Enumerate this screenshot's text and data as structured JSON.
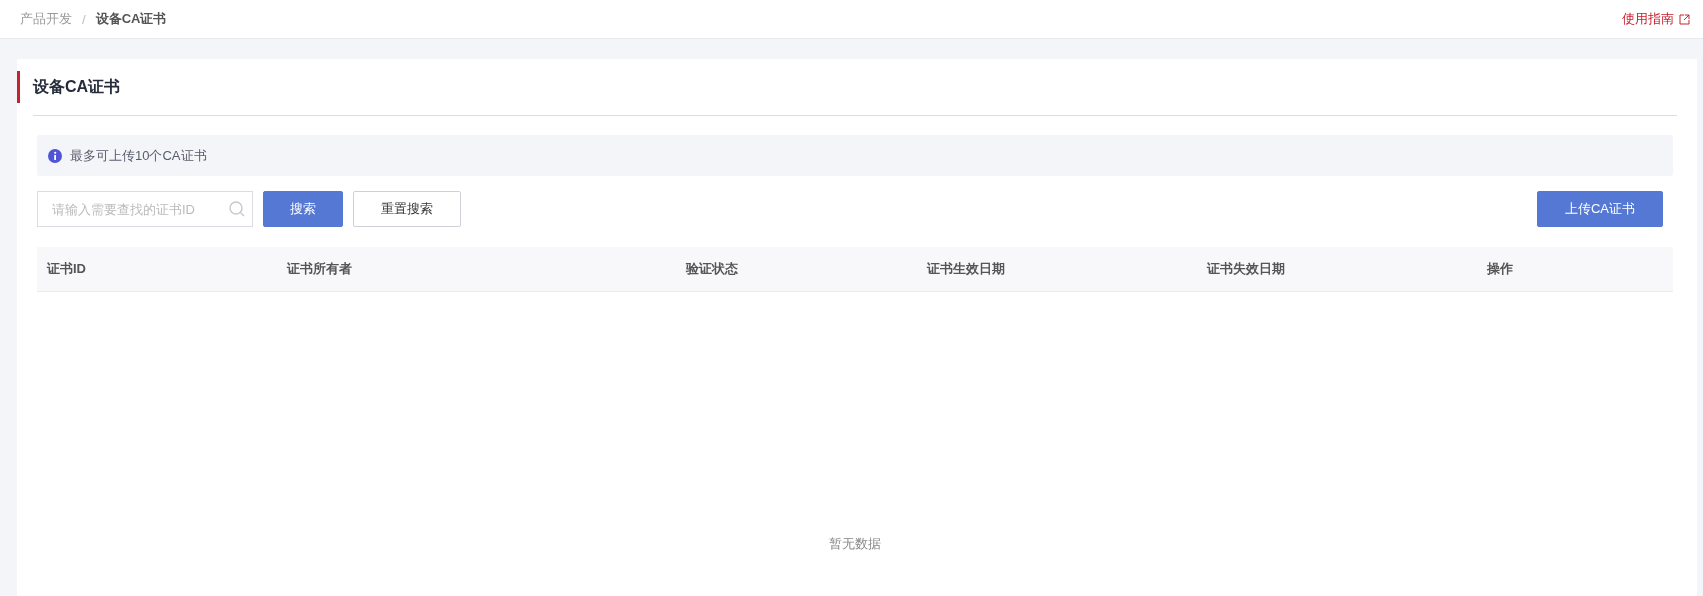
{
  "breadcrumb": [
    {
      "label": "产品开发",
      "current": false
    },
    {
      "label": "设备CA证书",
      "current": true
    }
  ],
  "separator": "/",
  "guide_link": {
    "label": "使用指南"
  },
  "page_title": "设备CA证书",
  "notice": "最多可上传10个CA证书",
  "search": {
    "placeholder": "请输入需要查找的证书ID"
  },
  "buttons": [
    {
      "label": "搜索",
      "kind": "primary"
    },
    {
      "label": "重置搜索",
      "kind": "default"
    }
  ],
  "upload_button": {
    "label": "上传CA证书"
  },
  "table": {
    "columns": [
      "证书ID",
      "证书所有者",
      "验证状态",
      "证书生效日期",
      "证书失效日期",
      "操作"
    ],
    "empty_text": "暂无数据"
  }
}
